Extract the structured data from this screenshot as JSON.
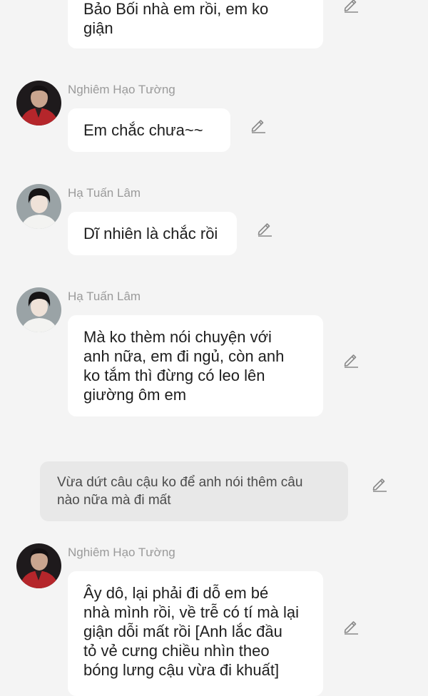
{
  "messages": [
    {
      "id": "m0",
      "sender": "",
      "text": "Bảo Bối nhà em rồi, em ko\ngiận",
      "icon": "pencil-icon"
    },
    {
      "id": "m1",
      "sender": "Nghiêm Hạo Tường",
      "text": "Em chắc chưa~~",
      "avatar": "avatar-red-jacket",
      "icon": "pencil-icon"
    },
    {
      "id": "m2",
      "sender": "Hạ Tuấn Lâm",
      "text": "Dĩ nhiên là chắc rồi",
      "avatar": "avatar-white-shirt",
      "icon": "pencil-icon"
    },
    {
      "id": "m3",
      "sender": "Hạ Tuấn Lâm",
      "text": "Mà ko thèm nói chuyện với\nanh nữa, em đi ngủ, còn anh\nko tắm thì đừng có leo lên\ngiường ôm em",
      "avatar": "avatar-white-shirt",
      "icon": "pencil-icon"
    },
    {
      "id": "n1",
      "type": "narration",
      "text": "Vừa dứt câu cậu ko để anh nói thêm câu\nnào nữa mà đi mất",
      "icon": "pencil-icon"
    },
    {
      "id": "m4",
      "sender": "Nghiêm Hạo Tường",
      "text": "Ây dô, lại phải đi dỗ em bé\nnhà mình rồi, về trễ có tí mà lại\ngiận dỗi mất rồi [Anh lắc đầu\ntỏ vẻ cưng chiều nhìn theo\nbóng lưng cậu vừa đi khuất]",
      "avatar": "avatar-red-jacket",
      "icon": "pencil-icon"
    }
  ],
  "colors": {
    "background": "#f4f4f4",
    "bubble": "#ffffff",
    "narration_bg": "#e8e8e8",
    "sender_text": "#9a9a9a",
    "icon": "#8a8a8a"
  }
}
